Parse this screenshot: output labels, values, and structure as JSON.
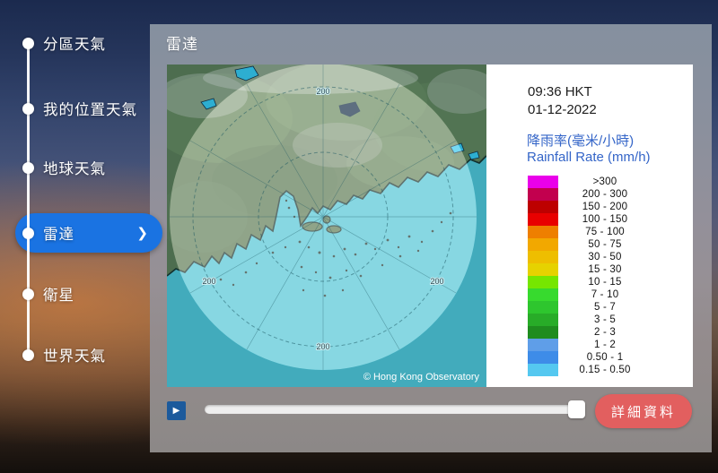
{
  "sidebar": {
    "items": [
      {
        "label": "分區天氣"
      },
      {
        "label": "我的位置天氣"
      },
      {
        "label": "地球天氣"
      },
      {
        "label": "雷達"
      },
      {
        "label": "衛星"
      },
      {
        "label": "世界天氣"
      }
    ],
    "selected_index": 3,
    "chevron": "❯"
  },
  "main": {
    "title": "雷達",
    "radar_image": {
      "timestamp_time": "09:36 HKT",
      "timestamp_date": "01-12-2022",
      "legend_title_zh": "降雨率(毫米/小時)",
      "legend_title_en": "Rainfall Rate (mm/h)",
      "copyright": "© Hong Kong Observatory",
      "range_ring_labels": {
        "top": "200",
        "left": "200",
        "right": "200",
        "bottom": "200"
      },
      "rainfall_scale": [
        {
          "range": ">300",
          "color": "#ea00ea"
        },
        {
          "range": "200 - 300",
          "color": "#c2004e"
        },
        {
          "range": "150 - 200",
          "color": "#bd0000"
        },
        {
          "range": "100 - 150",
          "color": "#e80000"
        },
        {
          "range": "75 - 100",
          "color": "#ee7f00"
        },
        {
          "range": "50 - 75",
          "color": "#f2a800"
        },
        {
          "range": "30 - 50",
          "color": "#eebe00"
        },
        {
          "range": "15 - 30",
          "color": "#e6d200"
        },
        {
          "range": "10 - 15",
          "color": "#76e600"
        },
        {
          "range": "7 - 10",
          "color": "#37da2e"
        },
        {
          "range": "5 - 7",
          "color": "#2ec62e"
        },
        {
          "range": "3 - 5",
          "color": "#28ac28"
        },
        {
          "range": "2 - 3",
          "color": "#1f8c1f"
        },
        {
          "range": "1 - 2",
          "color": "#5f9ee8"
        },
        {
          "range": "0.50 - 1",
          "color": "#3e8ce8"
        },
        {
          "range": "0.15 - 0.50",
          "color": "#55c8f0"
        }
      ]
    },
    "controls": {
      "play_icon": "▶",
      "details_label": "詳細資料"
    }
  }
}
